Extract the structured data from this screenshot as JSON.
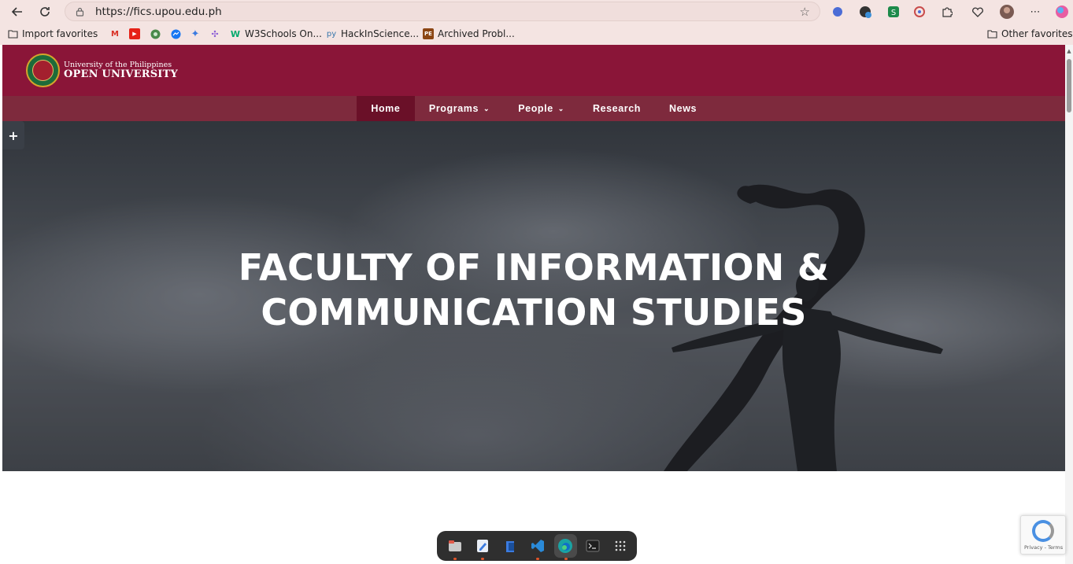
{
  "browser": {
    "url": "https://fics.upou.edu.ph",
    "bookmarks": [
      {
        "label": "Import favorites",
        "icon": "import-icon"
      },
      {
        "label": "",
        "icon": "gmail-icon"
      },
      {
        "label": "",
        "icon": "youtube-icon"
      },
      {
        "label": "",
        "icon": "chrome-extension-icon"
      },
      {
        "label": "",
        "icon": "messenger-icon"
      },
      {
        "label": "",
        "icon": "sparkle-icon"
      },
      {
        "label": "",
        "icon": "puzzle-icon"
      },
      {
        "label": "W3Schools On...",
        "icon": "w3schools-icon"
      },
      {
        "label": "HackInScience...",
        "icon": "hackinscience-icon"
      },
      {
        "label": "Archived Probl...",
        "icon": "project-euler-icon"
      }
    ],
    "other_favorites": "Other favorites",
    "colors": {
      "chrome": "#f4e4e2"
    }
  },
  "site": {
    "logo_line1": "University of the Philippines",
    "logo_line2": "OPEN UNIVERSITY",
    "nav": [
      {
        "label": "Home",
        "active": true,
        "dropdown": false
      },
      {
        "label": "Programs",
        "active": false,
        "dropdown": true
      },
      {
        "label": "People",
        "active": false,
        "dropdown": true
      },
      {
        "label": "Research",
        "active": false,
        "dropdown": false
      },
      {
        "label": "News",
        "active": false,
        "dropdown": false
      }
    ],
    "hero_title_line1": "FACULTY OF INFORMATION &",
    "hero_title_line2": "COMMUNICATION STUDIES",
    "plus_label": "+",
    "colors": {
      "brand": "#8a1538",
      "nav": "#7e2a3d",
      "nav_active": "#6a1028"
    }
  },
  "recaptcha": {
    "text": "Privacy - Terms"
  },
  "dock": {
    "apps": [
      {
        "icon": "files-icon",
        "active": false,
        "running": true
      },
      {
        "icon": "text-editor-icon",
        "active": false,
        "running": true
      },
      {
        "icon": "store-icon",
        "active": false,
        "running": false
      },
      {
        "icon": "vscode-icon",
        "active": false,
        "running": true
      },
      {
        "icon": "edge-icon",
        "active": true,
        "running": true
      },
      {
        "icon": "terminal-icon",
        "active": false,
        "running": false
      },
      {
        "icon": "app-grid-icon",
        "active": false,
        "running": false
      }
    ]
  }
}
